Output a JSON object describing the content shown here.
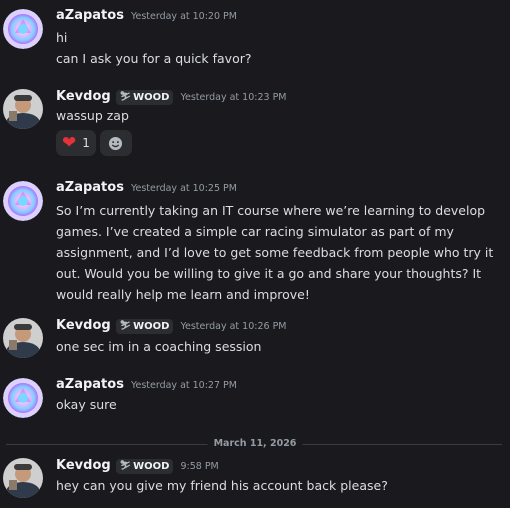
{
  "messages": [
    {
      "author": "aZapatos",
      "timestamp": "Yesterday at 10:20 PM",
      "lines": [
        "hi",
        "can I ask you for a quick favor?"
      ]
    },
    {
      "author": "Kevdog",
      "tag": "WOOD",
      "tag_icon": "ski-icon",
      "timestamp": "Yesterday at 10:23 PM",
      "lines": [
        "wassup zap"
      ],
      "reactions": [
        {
          "emoji": "heart",
          "count": "1"
        }
      ]
    },
    {
      "author": "aZapatos",
      "timestamp": "Yesterday at 10:25 PM",
      "text": "So I’m currently taking an IT course where we’re learning to develop games. I’ve created a simple car racing simulator as part of my assignment, and I’d love to get some feedback from people who try it out. Would you be willing to give it a go and share your thoughts? It would really help me learn and improve!"
    },
    {
      "author": "Kevdog",
      "tag": "WOOD",
      "tag_icon": "ski-icon",
      "timestamp": "Yesterday at 10:26 PM",
      "lines": [
        "one sec im in a coaching session"
      ]
    },
    {
      "author": "aZapatos",
      "timestamp": "Yesterday at 10:27 PM",
      "lines": [
        "okay sure"
      ]
    },
    {
      "author": "Kevdog",
      "tag": "WOOD",
      "tag_icon": "ski-icon",
      "timestamp": "9:58 PM",
      "lines": [
        "hey can you give my friend his account back please?"
      ]
    }
  ],
  "divider": {
    "date": "March 11, 2026"
  },
  "colors": {
    "background": "#1a1a1e",
    "text": "#dbdee1",
    "author": "#f2f3f5",
    "timestamp": "#949ba4",
    "reaction_bg": "#2b2d31",
    "heart": "#e5323a"
  }
}
